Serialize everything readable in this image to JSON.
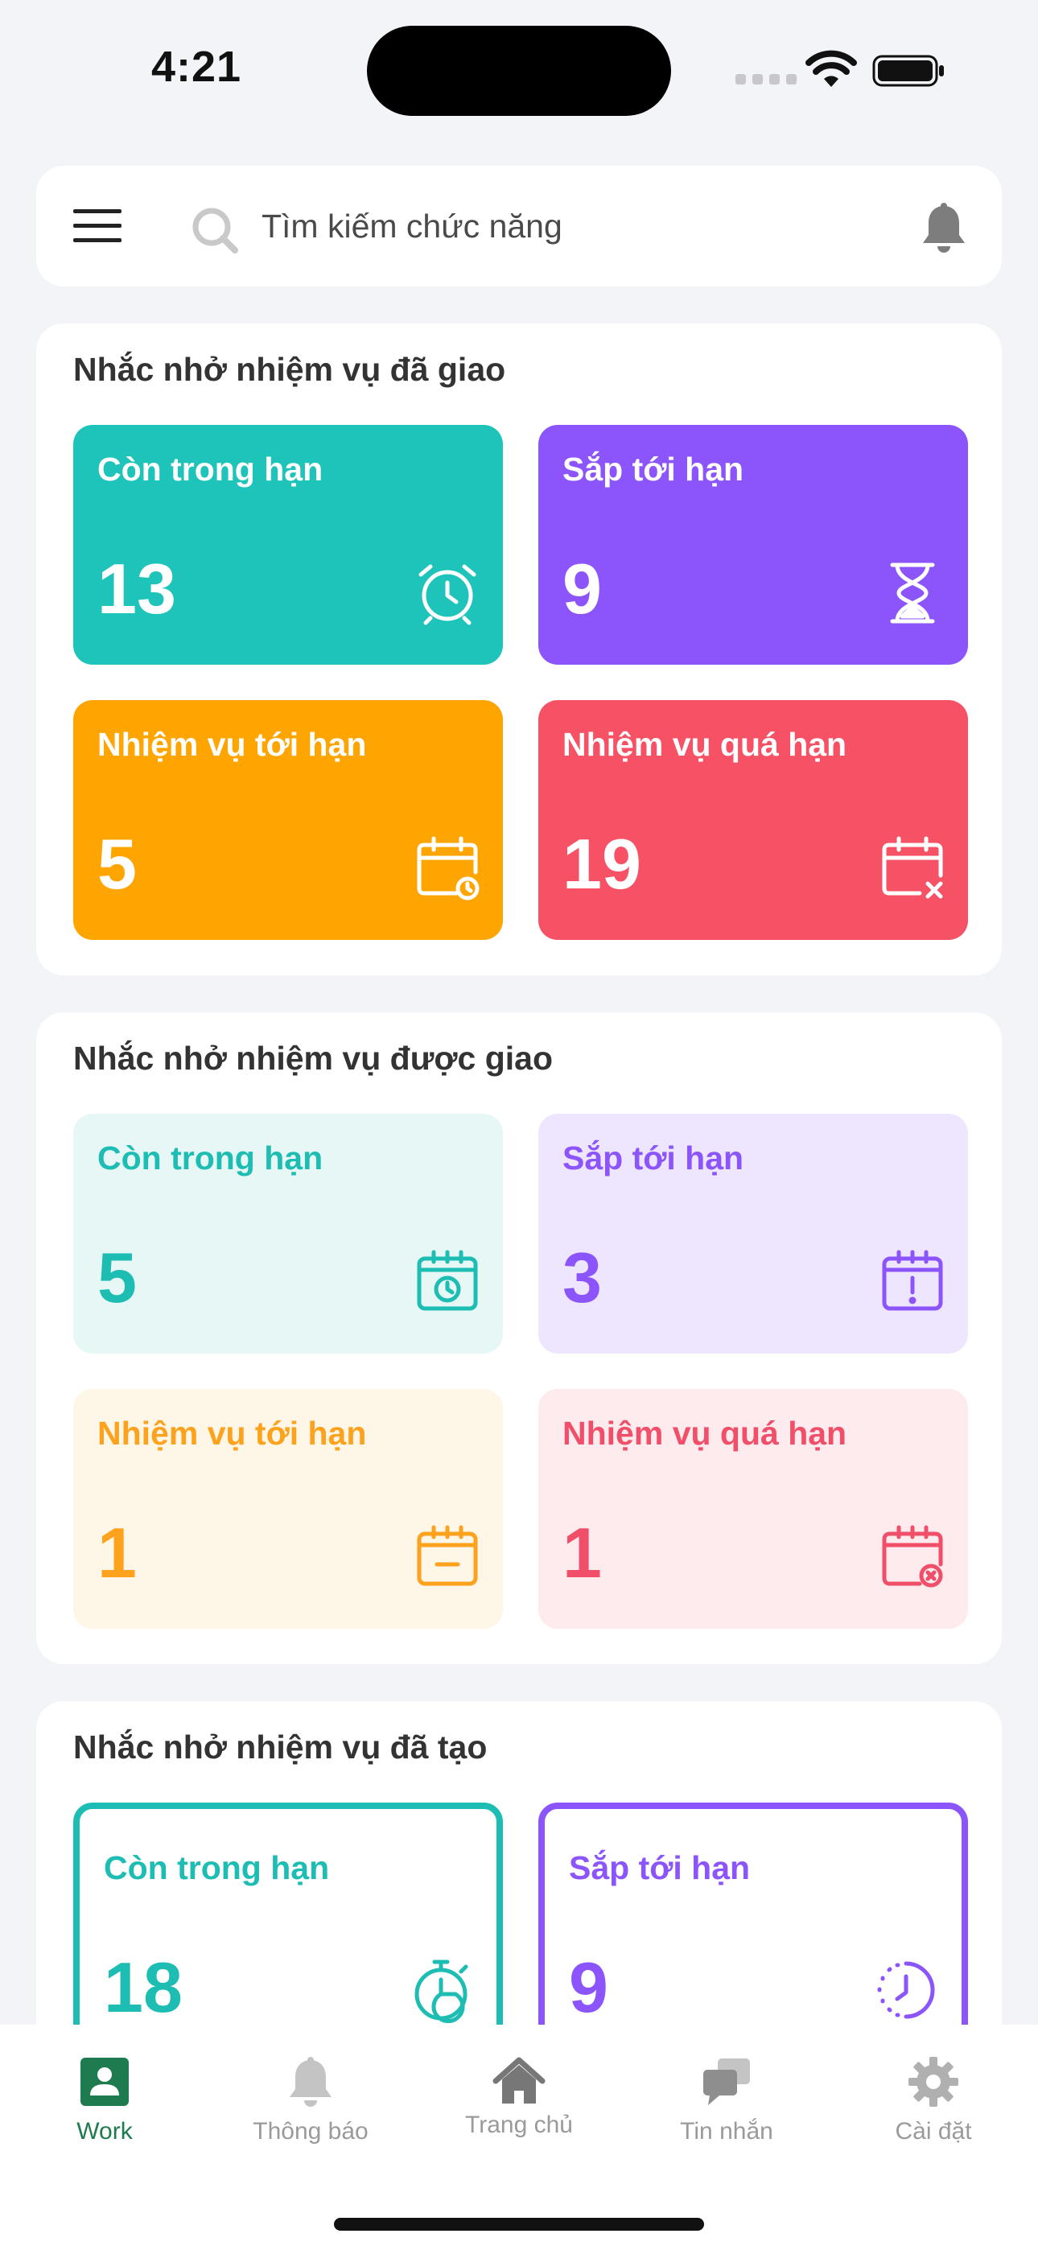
{
  "status_bar": {
    "time": "4:21"
  },
  "header": {
    "search_placeholder": "Tìm kiếm chức năng"
  },
  "sections": [
    {
      "title": "Nhắc nhở nhiệm vụ đã giao",
      "tiles": [
        {
          "label": "Còn trong hạn",
          "value": "13",
          "icon": "alarm-clock-icon",
          "color": "#1EC4B9"
        },
        {
          "label": "Sắp tới hạn",
          "value": "9",
          "icon": "hourglass-icon",
          "color": "#8B55FB"
        },
        {
          "label": "Nhiệm vụ tới hạn",
          "value": "5",
          "icon": "calendar-clock-icon",
          "color": "#FFA501"
        },
        {
          "label": "Nhiệm vụ quá hạn",
          "value": "19",
          "icon": "calendar-x-icon",
          "color": "#F65165"
        }
      ]
    },
    {
      "title": "Nhắc nhở nhiệm vụ được giao",
      "tiles": [
        {
          "label": "Còn trong hạn",
          "value": "5",
          "icon": "calendar-clock-icon",
          "color": "#1EBDB3",
          "bg": "#E6F7F5"
        },
        {
          "label": "Sắp tới hạn",
          "value": "3",
          "icon": "calendar-alert-icon",
          "color": "#8B55FB",
          "bg": "#EEE6FE"
        },
        {
          "label": "Nhiệm vụ tới hạn",
          "value": "1",
          "icon": "calendar-minus-icon",
          "color": "#FDA21D",
          "bg": "#FEF6E6"
        },
        {
          "label": "Nhiệm vụ quá hạn",
          "value": "1",
          "icon": "calendar-x-icon",
          "color": "#F14E6A",
          "bg": "#FEEBEE"
        }
      ]
    },
    {
      "title": "Nhắc nhở nhiệm vụ đã tạo",
      "tiles": [
        {
          "label": "Còn trong hạn",
          "value": "18",
          "icon": "stopwatch-icon",
          "color": "#1EBDB3"
        },
        {
          "label": "Sắp tới hạn",
          "value": "9",
          "icon": "clock-dashed-icon",
          "color": "#8B55FB"
        }
      ]
    }
  ],
  "bottom_nav": [
    {
      "label": "Work",
      "icon": "work-badge-icon",
      "active": true
    },
    {
      "label": "Thông báo",
      "icon": "bell-icon"
    },
    {
      "label": "Trang chủ",
      "icon": "home-icon"
    },
    {
      "label": "Tin nhắn",
      "icon": "chat-icon"
    },
    {
      "label": "Cài đặt",
      "icon": "gear-icon"
    }
  ],
  "colors": {
    "background": "#F2F4F7",
    "active_nav": "#1E7A4F",
    "inactive_nav": "#9A9A9A"
  }
}
